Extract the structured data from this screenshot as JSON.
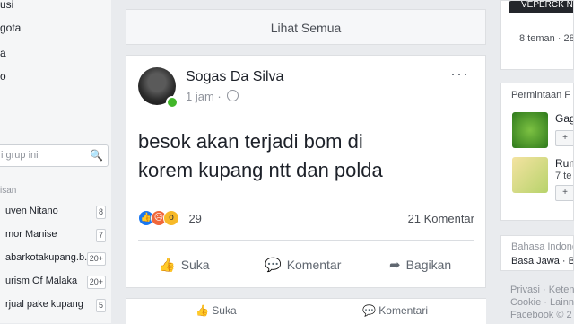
{
  "left_sidebar": {
    "items": [
      "usi",
      "gota",
      "a",
      "o"
    ],
    "search_placeholder": "i grup ini",
    "section_label": "isan",
    "groups": [
      {
        "name": "uven Nitano",
        "count": "8"
      },
      {
        "name": "mor Manise",
        "count": "7"
      },
      {
        "name": "abarkotakupang.b...",
        "count": "20+"
      },
      {
        "name": "urism Of Malaka",
        "count": "20+"
      },
      {
        "name": "rjual pake kupang",
        "count": "5"
      }
    ]
  },
  "feed": {
    "see_all": "Lihat Semua",
    "post": {
      "author": "Sogas Da Silva",
      "time": "1 jam · ",
      "more_label": "···",
      "text_line1": "besok akan terjadi bom di",
      "text_line2": "korem kupang ntt dan polda",
      "reaction_count": "29",
      "comment_count": "21 Komentar",
      "actions": {
        "like": "Suka",
        "comment": "Komentar",
        "share": "Bagikan"
      }
    },
    "next_post_actions": {
      "like": "Suka",
      "comment": "Komentari"
    }
  },
  "right_sidebar": {
    "top_title": "VEPERCK NGAE",
    "top_sub": "8 teman · 28",
    "requests_title": "Permintaan F",
    "requests": [
      {
        "name": "Gag",
        "sub": ""
      },
      {
        "name": "Rum",
        "sub": "7 te"
      }
    ],
    "language_title": "Bahasa Indone",
    "language_value": "Basa Jawa · Ba",
    "footer_line1": "Privasi · Keten",
    "footer_line2": "Cookie · Lainn",
    "footer_line3": "Facebook © 2"
  },
  "colors": {
    "accent": "#1877f2",
    "online": "#42b72a",
    "background": "#e9ebee"
  }
}
